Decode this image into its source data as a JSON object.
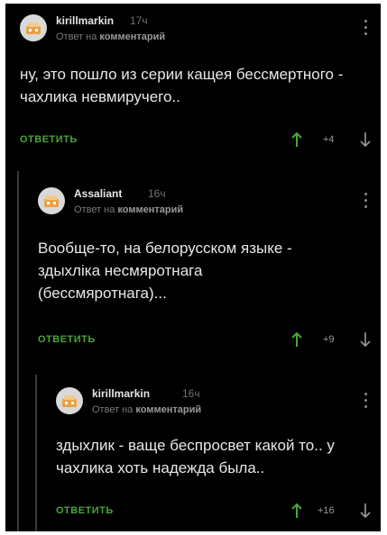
{
  "comments": [
    {
      "author": "kirillmarkin",
      "time": "17ч",
      "reply_prefix": "Ответ на",
      "reply_target": "комментарий",
      "text": "ну, это пошло из серии кащея бессмертного - чахлика невмиручего..",
      "reply_label": "ОТВЕТИТЬ",
      "score": "+4"
    },
    {
      "author": "Assaliant",
      "time": "16ч",
      "reply_prefix": "Ответ на",
      "reply_target": "комментарий",
      "text": "Вообще-то, на белорусском языке - здыхліка несмяротнага (бессмяротнага)...",
      "reply_label": "ОТВЕТИТЬ",
      "score": "+9"
    },
    {
      "author": "kirillmarkin",
      "time": "16ч",
      "reply_prefix": "Ответ на",
      "reply_target": "комментарий",
      "text": "здыхлик - ваще беспросвет какой то.. у чахлика хоть надежда была..",
      "reply_label": "ОТВЕТИТЬ",
      "score": "+16"
    }
  ],
  "colors": {
    "background": "#000000",
    "reply_accent": "#4aa53a",
    "upvote_accent": "#4aa53a",
    "text": "#e8e8e8",
    "muted": "#6f6f6f"
  },
  "icons": {
    "avatar": "avatar-icon",
    "more": "more-vertical-icon",
    "upvote": "arrow-up-icon",
    "downvote": "arrow-down-icon"
  }
}
